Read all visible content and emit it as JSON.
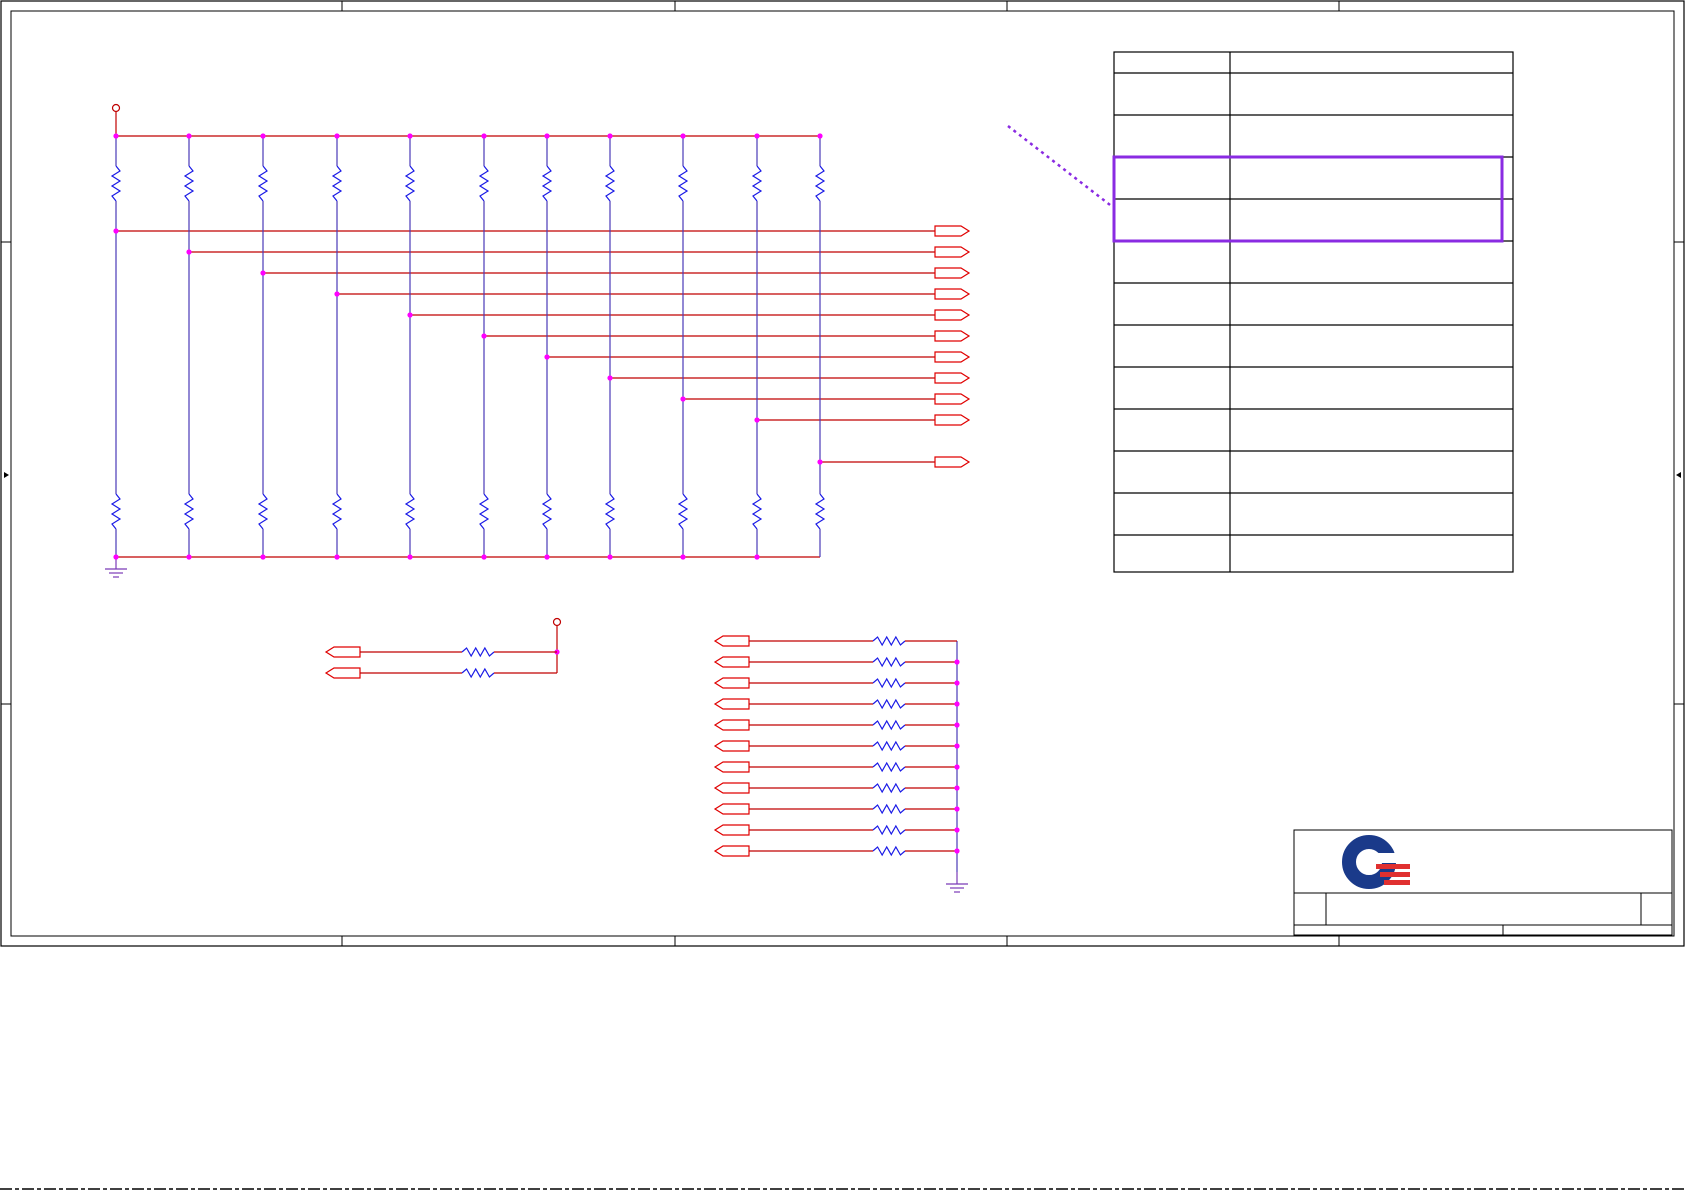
{
  "colors": {
    "wire": "#c00000",
    "resistor": "#1a1ae6",
    "junction": "#ff00ff",
    "port": "#e00000",
    "highlight": "#8a2be2",
    "logo_blue": "#1a3a8a",
    "logo_red": "#e03030"
  },
  "icons": {
    "power_symbol": "power-flag-icon",
    "ground_symbol": "ground-icon",
    "port_symbol": "off-page-connector-icon",
    "logo": "company-logo-icon"
  },
  "pullup_array": {
    "resistor_count": 11,
    "output_ports": 11
  },
  "small_pullup": {
    "resistor_count": 2,
    "input_ports": 2
  },
  "pulldown_array": {
    "resistor_count": 11,
    "input_ports": 11
  },
  "strap_table": {
    "rows": 12,
    "columns": 2,
    "highlighted_rows": [
      2,
      3
    ]
  },
  "title_block": {
    "title": "",
    "sheet": "",
    "rev": ""
  }
}
